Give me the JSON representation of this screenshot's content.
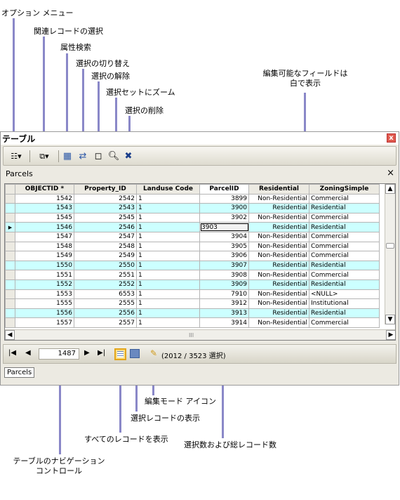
{
  "callouts": {
    "options_menu": "オプション メニュー",
    "related": "関連レコードの選択",
    "attr_search": "属性検索",
    "switch_sel": "選択の切り替え",
    "clear_sel": "選択の解除",
    "zoom_sel": "選択セットにズーム",
    "delete_sel": "選択の削除",
    "editable_1": "編集可能なフィールドは",
    "editable_2": "白で表示",
    "edit_mode_icon": "編集モード アイコン",
    "show_selected": "選択レコードの表示",
    "show_all": "すべてのレコードを表示",
    "sel_count": "選択数および総レコード数",
    "nav_1": "テーブルのナビゲーション",
    "nav_2": "コントロール"
  },
  "window": {
    "title": "テーブル",
    "close": "x",
    "table_tab": "Parcels",
    "table_close": "×",
    "bottom_tab": "Parcels"
  },
  "grid": {
    "columns": [
      "OBJECTID *",
      "Property_ID",
      "Landuse Code",
      "ParcelID",
      "Residential",
      "ZoningSimple"
    ],
    "rows": [
      {
        "oid": "1542",
        "pid": "2542",
        "lu": "1",
        "parcel": "3899",
        "res": "Non-Residential",
        "zone": "Commercial",
        "sel": false
      },
      {
        "oid": "1543",
        "pid": "2543",
        "lu": "1",
        "parcel": "3900",
        "res": "Residential",
        "zone": "Residential",
        "sel": true
      },
      {
        "oid": "1545",
        "pid": "2545",
        "lu": "1",
        "parcel": "3902",
        "res": "Non-Residential",
        "zone": "Commercial",
        "sel": false
      },
      {
        "oid": "1546",
        "pid": "2546",
        "lu": "1",
        "parcel": "3903",
        "res": "Residential",
        "zone": "Residential",
        "sel": true,
        "current": true
      },
      {
        "oid": "1547",
        "pid": "2547",
        "lu": "1",
        "parcel": "3904",
        "res": "Non-Residential",
        "zone": "Commercial",
        "sel": false
      },
      {
        "oid": "1548",
        "pid": "2548",
        "lu": "1",
        "parcel": "3905",
        "res": "Non-Residential",
        "zone": "Commercial",
        "sel": false
      },
      {
        "oid": "1549",
        "pid": "2549",
        "lu": "1",
        "parcel": "3906",
        "res": "Non-Residential",
        "zone": "Commercial",
        "sel": false
      },
      {
        "oid": "1550",
        "pid": "2550",
        "lu": "1",
        "parcel": "3907",
        "res": "Residential",
        "zone": "Residential",
        "sel": true
      },
      {
        "oid": "1551",
        "pid": "2551",
        "lu": "1",
        "parcel": "3908",
        "res": "Non-Residential",
        "zone": "Commercial",
        "sel": false
      },
      {
        "oid": "1552",
        "pid": "2552",
        "lu": "1",
        "parcel": "3909",
        "res": "Residential",
        "zone": "Residential",
        "sel": true
      },
      {
        "oid": "1553",
        "pid": "6553",
        "lu": "1",
        "parcel": "7910",
        "res": "Non-Residential",
        "zone": "<NULL>",
        "sel": false
      },
      {
        "oid": "1555",
        "pid": "2555",
        "lu": "1",
        "parcel": "3912",
        "res": "Non-Residential",
        "zone": "Institutional",
        "sel": false
      },
      {
        "oid": "1556",
        "pid": "2556",
        "lu": "1",
        "parcel": "3913",
        "res": "Residential",
        "zone": "Residential",
        "sel": true
      },
      {
        "oid": "1557",
        "pid": "2557",
        "lu": "1",
        "parcel": "3914",
        "res": "Non-Residential",
        "zone": "Commercial",
        "sel": false
      }
    ],
    "hscroll_grip": "III"
  },
  "navbar": {
    "first": "|◀",
    "prev": "◀",
    "current_record": "1487",
    "next": "▶",
    "last": "▶|",
    "selection_text": "(2012 / 3523 選択)"
  },
  "colors": {
    "selected_row": "#ccffff",
    "leader_line": "#8a88c8"
  }
}
